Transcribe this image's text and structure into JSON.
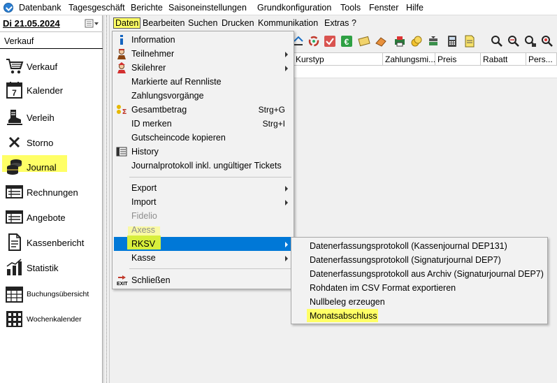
{
  "top_menu": [
    "Datenbank",
    "Tagesgeschäft",
    "Berichte",
    "Saisoneinstellungen",
    "Grundkonfiguration",
    "Tools",
    "Fenster",
    "Hilfe"
  ],
  "sidebar": {
    "date": "Di  21.05.2024",
    "section_title": "Verkauf",
    "items": [
      {
        "label": "Verkauf",
        "icon": "shopping-cart-icon"
      },
      {
        "label": "Kalender",
        "icon": "calendar-icon"
      },
      {
        "label": "Verleih",
        "icon": "ski-boot-icon"
      },
      {
        "label": "Storno",
        "icon": "x-icon"
      },
      {
        "label": "Journal",
        "icon": "coins-icon"
      },
      {
        "label": "Rechnungen",
        "icon": "list-icon"
      },
      {
        "label": "Angebote",
        "icon": "list-icon"
      },
      {
        "label": "Kassenbericht",
        "icon": "document-icon"
      },
      {
        "label": "Statistik",
        "icon": "bar-chart-icon"
      },
      {
        "label": "Buchungsübersicht",
        "icon": "table-calendar-icon"
      },
      {
        "label": "Wochenkalender",
        "icon": "grid-icon"
      }
    ]
  },
  "inner_menu": [
    "Daten",
    "Bearbeiten",
    "Suchen",
    "Drucken",
    "Kommunikation",
    "Extras",
    "?"
  ],
  "grid": {
    "columns": [
      "Kurstyp",
      "Zahlungsmi...",
      "Preis",
      "Rabatt",
      "Pers..."
    ]
  },
  "dropdown": {
    "items": [
      {
        "label": "Information",
        "shortcut": "",
        "icon": "info-icon"
      },
      {
        "label": "Teilnehmer",
        "shortcut": "",
        "icon": "participant-icon"
      },
      {
        "label": "Skilehrer",
        "shortcut": "",
        "icon": "ski-teacher-icon"
      },
      {
        "label": "Markierte auf Rennliste",
        "shortcut": "",
        "icon": ""
      },
      {
        "label": "Zahlungsvorgänge",
        "shortcut": "",
        "icon": ""
      },
      {
        "label": "Gesamtbetrag",
        "shortcut": "Strg+G",
        "icon": "sum-icon"
      },
      {
        "label": "ID merken",
        "shortcut": "Strg+I",
        "icon": ""
      },
      {
        "label": "Gutscheincode kopieren",
        "shortcut": "",
        "icon": ""
      },
      {
        "label": "History",
        "shortcut": "",
        "icon": "history-icon"
      },
      {
        "label": "Journalprotokoll inkl. ungültiger Tickets",
        "shortcut": "",
        "icon": ""
      },
      {
        "label": "Export",
        "shortcut": "",
        "icon": ""
      },
      {
        "label": "Import",
        "shortcut": "",
        "icon": ""
      },
      {
        "label": "Fidelio",
        "shortcut": "",
        "icon": ""
      },
      {
        "label": "Axess",
        "shortcut": "",
        "icon": ""
      },
      {
        "label": "RKSV",
        "shortcut": "",
        "icon": ""
      },
      {
        "label": "Kasse",
        "shortcut": "",
        "icon": ""
      },
      {
        "label": "Schließen",
        "shortcut": "",
        "icon": "exit-icon"
      }
    ],
    "exit_badge": "EXIT"
  },
  "submenu": {
    "items": [
      "Datenerfassungsprotokoll (Kassenjournal DEP131)",
      "Datenerfassungsprotokoll (Signaturjournal DEP7)",
      "Datenerfassungsprotokoll aus Archiv (Signaturjournal DEP7)",
      "Rohdaten im CSV Format exportieren",
      "Nullbeleg erzeugen",
      "Monatsabschluss"
    ]
  },
  "colors": {
    "highlight": "#ffff66",
    "selection": "#0078d7",
    "rksv_highlight": "#d8ef3c"
  }
}
